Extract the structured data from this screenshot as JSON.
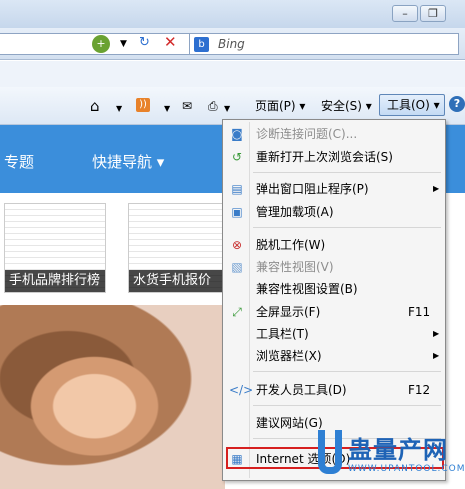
{
  "toolbar": {
    "search_placeholder": "Bing",
    "page_label": "页面(P)",
    "safety_label": "安全(S)",
    "tools_label": "工具(O)",
    "icons": [
      "home-icon",
      "rss-icon",
      "mail-icon",
      "print-icon",
      "help-icon"
    ]
  },
  "page": {
    "nav_left": "专题",
    "nav_quick": "快捷导航 ▾",
    "thumb1_caption": "手机品牌排行榜",
    "thumb2_caption": "水货手机报价"
  },
  "menu": {
    "items": [
      {
        "label": "诊断连接问题(C)...",
        "disabled": true
      },
      {
        "label": "重新打开上次浏览会话(S)"
      },
      {
        "label": "弹出窗口阻止程序(P)",
        "submenu": true
      },
      {
        "label": "管理加载项(A)"
      },
      {
        "label": "脱机工作(W)"
      },
      {
        "label": "兼容性视图(V)",
        "disabled": true
      },
      {
        "label": "兼容性视图设置(B)"
      },
      {
        "label": "全屏显示(F)",
        "shortcut": "F11"
      },
      {
        "label": "工具栏(T)",
        "submenu": true
      },
      {
        "label": "浏览器栏(X)",
        "submenu": true
      },
      {
        "label": "开发人员工具(D)",
        "shortcut": "F12"
      },
      {
        "label": "建议网站(G)"
      },
      {
        "label": "Internet 选项(O)"
      }
    ]
  },
  "watermark": {
    "title": "蛊量产网",
    "site": "WWW.UPANTOOL.COM"
  }
}
